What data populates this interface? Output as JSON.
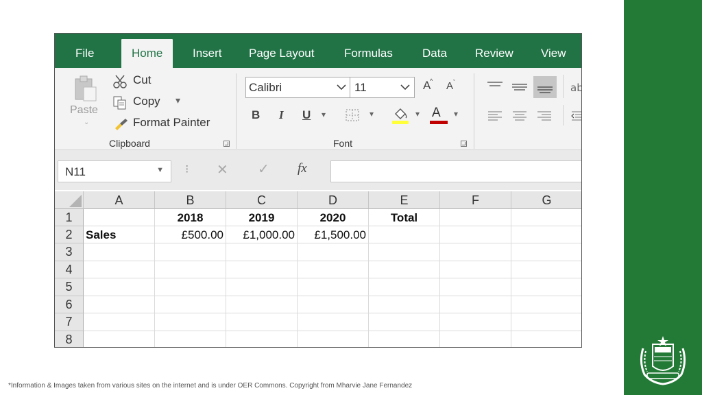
{
  "menu": {
    "tabs": [
      {
        "label": "File"
      },
      {
        "label": "Home"
      },
      {
        "label": "Insert"
      },
      {
        "label": "Page Layout"
      },
      {
        "label": "Formulas"
      },
      {
        "label": "Data"
      },
      {
        "label": "Review"
      },
      {
        "label": "View"
      }
    ],
    "active_tab": "Home"
  },
  "ribbon": {
    "clipboard": {
      "paste": "Paste",
      "cut": "Cut",
      "copy": "Copy",
      "format_painter": "Format Painter",
      "group_label": "Clipboard"
    },
    "font": {
      "font_name": "Calibri",
      "font_size": "11",
      "bold": "B",
      "italic": "I",
      "underline": "U",
      "group_label": "Font"
    }
  },
  "formula_bar": {
    "name_box": "N11",
    "fx": "fx",
    "value": ""
  },
  "sheet": {
    "columns": [
      "A",
      "B",
      "C",
      "D",
      "E",
      "F",
      "G"
    ],
    "rows": [
      "1",
      "2",
      "3",
      "4",
      "5",
      "6",
      "7",
      "8"
    ],
    "cells": {
      "B1": "2018",
      "C1": "2019",
      "D1": "2020",
      "E1": "Total",
      "A2": "Sales",
      "B2": "£500.00",
      "C2": "£1,000.00",
      "D2": "£1,500.00"
    }
  },
  "footnote": "*Information & Images taken from various sites on the internet and is under OER Commons. Copyright from Mharvie Jane Fernandez",
  "colors": {
    "excel_green": "#217346",
    "slide_green": "#237a37"
  }
}
